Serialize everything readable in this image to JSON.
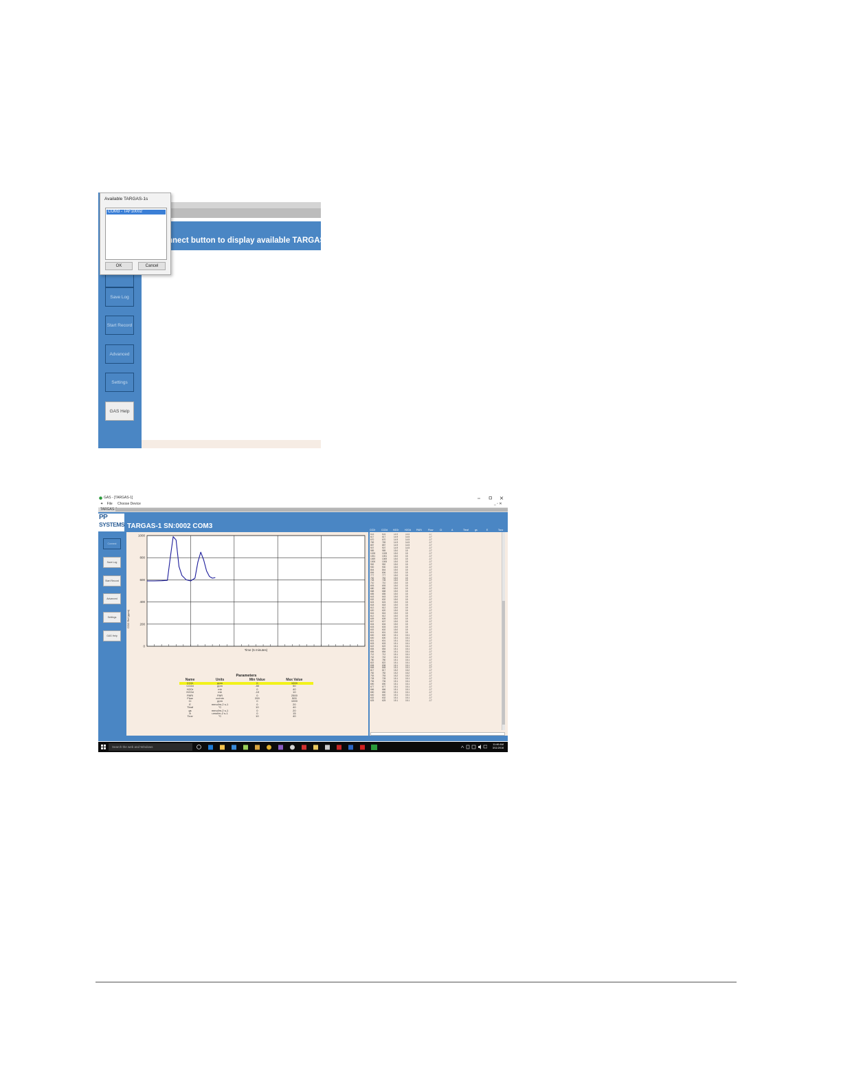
{
  "shot1": {
    "banner_text": "nnect button to display available TARGAS",
    "side_buttons": [
      {
        "label": "Save Log"
      },
      {
        "label": "Start Record"
      },
      {
        "label": "Advanced"
      },
      {
        "label": "Settings"
      },
      {
        "label": "GAS Help"
      }
    ],
    "dialog": {
      "title": "Available TARGAS-1s",
      "items": [
        "COM3 - TAF10002"
      ],
      "ok_label": "OK",
      "cancel_label": "Cancel"
    }
  },
  "shot2": {
    "window_title": "GAS - [TARGAS-1]",
    "menu": {
      "file": "File",
      "choose_device": "Choose Device"
    },
    "tab_label": "TARGAS-1",
    "logo_lines": [
      "PP",
      "SYSTEMS"
    ],
    "heading": "TARGAS-1 SN:0002 COM3",
    "side_buttons": [
      "Connect",
      "Save Log",
      "Start Record",
      "Advanced",
      "Settings",
      "GAS Help"
    ],
    "chart_data": {
      "type": "line",
      "title": "",
      "xlabel": "Time (5 minutes)",
      "ylabel": "CO2 Ref (ppm)",
      "ylim": [
        0,
        1000
      ],
      "yticks": [
        "0",
        "200",
        "400",
        "600",
        "800",
        "1000"
      ],
      "grid": true,
      "series": [
        {
          "name": "",
          "color": "#1a1a9a",
          "x": [
            0,
            0.5,
            1.0,
            1.4,
            1.6,
            1.8,
            2.0,
            2.2,
            2.4,
            2.7,
            3.0,
            3.3,
            3.5,
            3.7,
            3.9,
            4.1,
            4.3,
            4.5,
            4.7
          ],
          "y": [
            590,
            590,
            592,
            595,
            800,
            990,
            960,
            720,
            640,
            600,
            590,
            615,
            760,
            850,
            780,
            680,
            630,
            615,
            620
          ]
        }
      ],
      "xlim": [
        0,
        15
      ]
    },
    "parameters": {
      "title": "Parameters",
      "headers": [
        "Name",
        "Units",
        "Min Value",
        "Max Value"
      ],
      "rows": [
        [
          "CO2r",
          "ppm",
          "0",
          "1000"
        ],
        [
          "CO2d",
          "ppm",
          "-50",
          "50"
        ],
        [
          "H2Or",
          "mb",
          "0",
          "40"
        ],
        [
          "H2Od",
          "mb",
          "-10",
          "10"
        ],
        [
          "PARi",
          "PAR",
          "0",
          "2500"
        ],
        [
          "Flow",
          "cc/min",
          "200",
          "500"
        ],
        [
          "Ci",
          "ppm",
          "0",
          "1000"
        ],
        [
          "E",
          "mmol/m-2 s-1",
          "0",
          "20"
        ],
        [
          "Tleaf",
          "°C",
          "10",
          "40"
        ],
        [
          "gs",
          "mmol/m-2 s-1",
          "0",
          "20"
        ],
        [
          "A",
          "umol/m-2 s-1",
          "0",
          "15"
        ],
        [
          "Tcuv",
          "°C",
          "10",
          "40"
        ]
      ]
    },
    "data_table": {
      "headers": [
        "CO2r",
        "CO2d",
        "H2Or",
        "H2Od",
        "PARi",
        "Flow",
        "Ci",
        "A",
        "Tleaf",
        "gs",
        "E",
        "Tcuv"
      ],
      "rows": [
        [
          "603",
          "603",
          "14.9",
          "14.5",
          "",
          "-17"
        ],
        [
          "617",
          "617",
          "14.9",
          "14.5",
          "",
          "-17"
        ],
        [
          "670",
          "670",
          "14.9",
          "14.5",
          "",
          "-17"
        ],
        [
          "769",
          "769",
          "14.9",
          "14.5",
          "",
          "-17"
        ],
        [
          "857",
          "857",
          "14.9",
          "14.5",
          "",
          "-17"
        ],
        [
          "907",
          "907",
          "14.9",
          "14.5",
          "",
          "-17"
        ],
        [
          "989",
          "989",
          "15.0",
          "15",
          "",
          "-17"
        ],
        [
          "1028",
          "1028",
          "15.0",
          "15",
          "",
          "-17"
        ],
        [
          "1051",
          "1051",
          "15.0",
          "15",
          "",
          "-17"
        ],
        [
          "1069",
          "1069",
          "15.0",
          "15",
          "",
          "-17"
        ],
        [
          "1006",
          "1006",
          "15.0",
          "15",
          "",
          "-17"
        ],
        [
          "952",
          "952",
          "15.0",
          "15",
          "",
          "-17"
        ],
        [
          "900",
          "900",
          "15.0",
          "15",
          "",
          "-17"
        ],
        [
          "844",
          "844",
          "15.0",
          "15",
          "",
          "-17"
        ],
        [
          "806",
          "806",
          "15.0",
          "15",
          "",
          "-17"
        ],
        [
          "777",
          "777",
          "15.0",
          "15",
          "",
          "-17"
        ],
        [
          "752",
          "752",
          "15.0",
          "15",
          "",
          "-17"
        ],
        [
          "728",
          "728",
          "15.0",
          "15",
          "",
          "-17"
        ],
        [
          "710",
          "710",
          "15.0",
          "15",
          "",
          "-17"
        ],
        [
          "693",
          "693",
          "15.0",
          "15",
          "",
          "-17"
        ],
        [
          "680",
          "680",
          "15.0",
          "15",
          "",
          "-17"
        ],
        [
          "668",
          "668",
          "15.0",
          "15",
          "",
          "-17"
        ],
        [
          "655",
          "655",
          "15.0",
          "15",
          "",
          "-17"
        ],
        [
          "643",
          "643",
          "15.0",
          "15",
          "",
          "-17"
        ],
        [
          "632",
          "632",
          "15.0",
          "15",
          "",
          "-17"
        ],
        [
          "624",
          "624",
          "15.0",
          "15",
          "",
          "-17"
        ],
        [
          "618",
          "618",
          "15.0",
          "15",
          "",
          "-17"
        ],
        [
          "612",
          "612",
          "15.0",
          "15",
          "",
          "-17"
        ],
        [
          "620",
          "620",
          "15.0",
          "15",
          "",
          "-17"
        ],
        [
          "616",
          "616",
          "15.0",
          "15",
          "",
          "-17"
        ],
        [
          "612",
          "612",
          "15.0",
          "15",
          "",
          "-17"
        ],
        [
          "609",
          "609",
          "15.0",
          "15",
          "",
          "-17"
        ],
        [
          "607",
          "607",
          "15.0",
          "15",
          "",
          "-17"
        ],
        [
          "604",
          "604",
          "15.0",
          "15",
          "",
          "-17"
        ],
        [
          "603",
          "603",
          "15.0",
          "15",
          "",
          "-17"
        ],
        [
          "602",
          "602",
          "15.0",
          "15",
          "",
          "-17"
        ],
        [
          "601",
          "601",
          "15.0",
          "15",
          "",
          "-17"
        ],
        [
          "600",
          "600",
          "15.1",
          "15.1",
          "",
          "-17"
        ],
        [
          "600",
          "600",
          "15.1",
          "15.1",
          "",
          "-17"
        ],
        [
          "601",
          "601",
          "15.1",
          "15.1",
          "",
          "-17"
        ],
        [
          "603",
          "603",
          "15.1",
          "15.1",
          "",
          "-17"
        ],
        [
          "622",
          "622",
          "15.1",
          "15.1",
          "",
          "-17"
        ],
        [
          "654",
          "654",
          "15.1",
          "15.1",
          "",
          "-17"
        ],
        [
          "684",
          "684",
          "15.1",
          "15.1",
          "",
          "-17"
        ],
        [
          "712",
          "712",
          "15.1",
          "15.1",
          "",
          "-17"
        ],
        [
          "742",
          "742",
          "15.1",
          "15.1",
          "",
          "-17"
        ],
        [
          "780",
          "780",
          "15.1",
          "15.1",
          "",
          "-17"
        ],
        [
          "822",
          "822",
          "15.1",
          "15.1",
          "",
          "-17"
        ],
        [
          "838",
          "838",
          "15.1",
          "15.1",
          "",
          "-17"
        ],
        [
          "848",
          "848",
          "15.1",
          "15.1",
          "",
          "-17"
        ],
        [
          "817",
          "817",
          "15.2",
          "15.2",
          "",
          "-17"
        ],
        [
          "782",
          "782",
          "15.2",
          "15.2",
          "",
          "-17"
        ],
        [
          "753",
          "753",
          "15.2",
          "15.2",
          "",
          "-17"
        ],
        [
          "728",
          "728",
          "15.1",
          "15.1",
          "",
          "-17"
        ],
        [
          "706",
          "706",
          "15.1",
          "15.1",
          "",
          "-17"
        ],
        [
          "690",
          "690",
          "15.1",
          "15.1",
          "",
          "-17"
        ],
        [
          "677",
          "677",
          "15.1",
          "15.1",
          "",
          "-17"
        ],
        [
          "666",
          "666",
          "15.1",
          "15.1",
          "",
          "-17"
        ],
        [
          "650",
          "650",
          "15.1",
          "15.1",
          "",
          "-17"
        ],
        [
          "640",
          "640",
          "15.1",
          "15.1",
          "",
          "-17"
        ],
        [
          "632",
          "632",
          "15.1",
          "15.1",
          "",
          "-17"
        ],
        [
          "625",
          "625",
          "15.1",
          "15.1",
          "",
          "-17"
        ]
      ]
    },
    "taskbar": {
      "search_placeholder": "Search the web and Windows",
      "time": "11:46 AM",
      "date": "3/11/2016"
    }
  }
}
